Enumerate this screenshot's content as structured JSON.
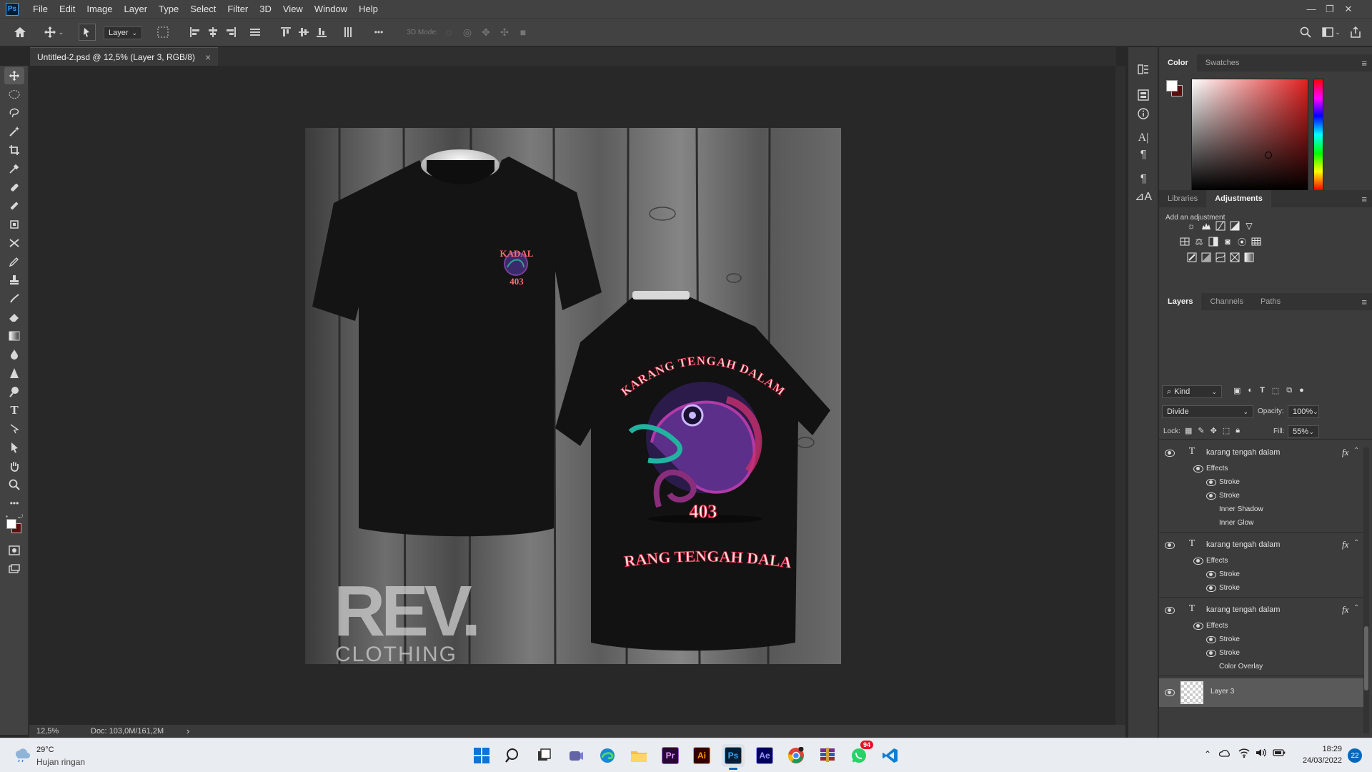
{
  "app": {
    "name": "Ps",
    "brand_color": "#31a8ff"
  },
  "menu": [
    "File",
    "Edit",
    "Image",
    "Layer",
    "Type",
    "Select",
    "Filter",
    "3D",
    "View",
    "Window",
    "Help"
  ],
  "window_controls": {
    "minimize": "—",
    "restore": "❐",
    "close": "✕"
  },
  "options_bar": {
    "auto_select_target": "Layer",
    "mode_3d_label": "3D Mode:",
    "more": "•••"
  },
  "document": {
    "tab_title": "Untitled-2.psd @ 12,5% (Layer 3, RGB/8)",
    "close": "×"
  },
  "canvas": {
    "front_logo_top": "KADAL",
    "front_logo_num": "403",
    "back_arc_text": "KARANG TENGAH DALAM",
    "back_number": "403",
    "back_bottom_text": "KARANG TENGAH DALAM",
    "watermark_big": "REV.",
    "watermark_small": "CLOTHING"
  },
  "status": {
    "zoom": "12,5%",
    "doc": "Doc: 103,0M/161,2M",
    "arrow": "›"
  },
  "color_panel": {
    "tabs": [
      "Color",
      "Swatches"
    ],
    "hue_color": "#e02020",
    "foreground": "#ffffff",
    "background": "#5a0f0f"
  },
  "adjustments_panel": {
    "tabs": [
      "Libraries",
      "Adjustments"
    ],
    "caption": "Add an adjustment"
  },
  "layers_panel": {
    "tabs": [
      "Layers",
      "Channels",
      "Paths"
    ],
    "filter_kind": "Kind",
    "blend_mode": "Divide",
    "opacity_label": "Opacity:",
    "opacity_value": "100%",
    "lock_label": "Lock:",
    "fill_label": "Fill:",
    "fill_value": "55%",
    "layers": [
      {
        "name": "karang tengah dalam",
        "fx": "fx",
        "effects_label": "Effects",
        "effects": [
          {
            "name": "Stroke",
            "visible": true
          },
          {
            "name": "Stroke",
            "visible": true
          },
          {
            "name": "Inner Shadow",
            "visible": false
          },
          {
            "name": "Inner Glow",
            "visible": false
          }
        ]
      },
      {
        "name": "karang tengah dalam",
        "fx": "fx",
        "effects_label": "Effects",
        "effects": [
          {
            "name": "Stroke",
            "visible": true
          },
          {
            "name": "Stroke",
            "visible": true
          }
        ]
      },
      {
        "name": "karang tengah dalam",
        "fx": "fx",
        "effects_label": "Effects",
        "effects": [
          {
            "name": "Stroke",
            "visible": true
          },
          {
            "name": "Stroke",
            "visible": true
          },
          {
            "name": "Color Overlay",
            "visible": false
          }
        ]
      }
    ],
    "raster_layer": "Layer 3"
  },
  "taskbar": {
    "weather_temp": "29°C",
    "weather_desc": "Hujan ringan",
    "time": "18:29",
    "date": "24/03/2022",
    "notif_count": "22",
    "whatsapp_badge": "94",
    "apps": [
      {
        "name": "start-icon",
        "label": ""
      },
      {
        "name": "search-icon",
        "label": ""
      },
      {
        "name": "task-view-icon",
        "label": ""
      },
      {
        "name": "teams-icon",
        "label": ""
      },
      {
        "name": "edge-icon",
        "label": ""
      },
      {
        "name": "explorer-icon",
        "label": ""
      },
      {
        "name": "premiere-icon",
        "label": "Pr"
      },
      {
        "name": "illustrator-icon",
        "label": "Ai"
      },
      {
        "name": "photoshop-icon",
        "label": "Ps"
      },
      {
        "name": "after-effects-icon",
        "label": "Ae"
      },
      {
        "name": "chrome-icon",
        "label": ""
      },
      {
        "name": "winrar-icon",
        "label": ""
      },
      {
        "name": "whatsapp-icon",
        "label": ""
      },
      {
        "name": "vscode-icon",
        "label": ""
      }
    ]
  }
}
